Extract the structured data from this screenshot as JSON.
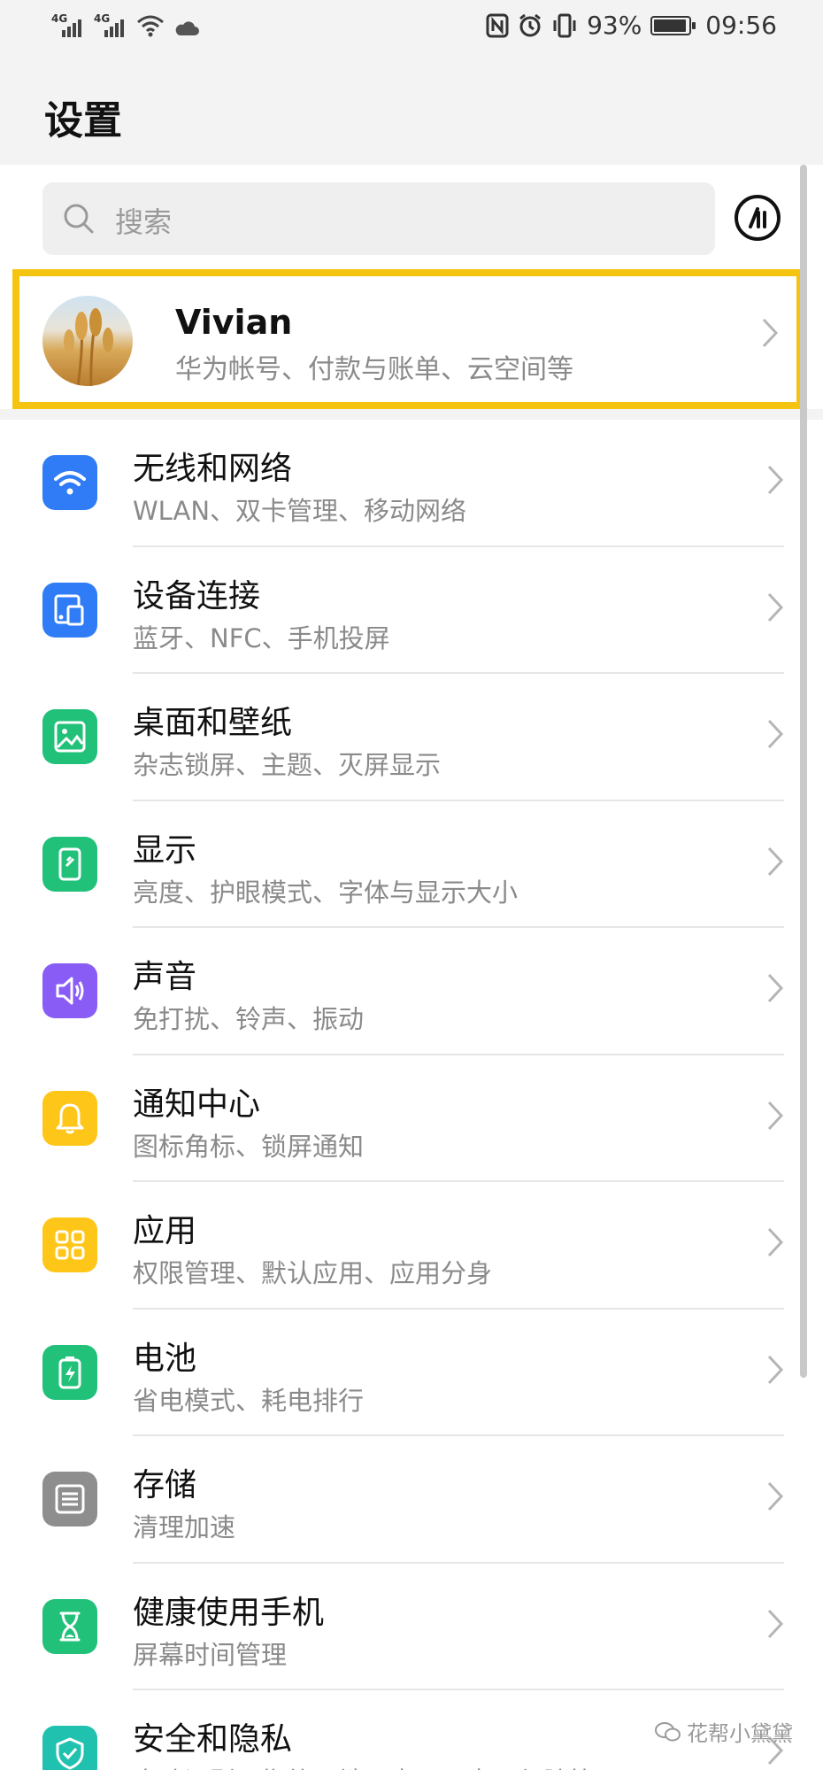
{
  "status_bar": {
    "signal_1": "4G",
    "signal_2": "4G",
    "battery": "93%",
    "time": "09:56"
  },
  "header": {
    "title": "设置"
  },
  "search": {
    "placeholder": "搜索"
  },
  "account": {
    "name": "Vivian",
    "subtitle": "华为帐号、付款与账单、云空间等"
  },
  "items": [
    {
      "title": "无线和网络",
      "sub": "WLAN、双卡管理、移动网络",
      "icon": "wifi-icon",
      "color": "#2f7cf6"
    },
    {
      "title": "设备连接",
      "sub": "蓝牙、NFC、手机投屏",
      "icon": "device-connection-icon",
      "color": "#2f7cf6"
    },
    {
      "title": "桌面和壁纸",
      "sub": "杂志锁屏、主题、灭屏显示",
      "icon": "wallpaper-icon",
      "color": "#21c17a"
    },
    {
      "title": "显示",
      "sub": "亮度、护眼模式、字体与显示大小",
      "icon": "display-icon",
      "color": "#21c17a"
    },
    {
      "title": "声音",
      "sub": "免打扰、铃声、振动",
      "icon": "sound-icon",
      "color": "#8a5cf6"
    },
    {
      "title": "通知中心",
      "sub": "图标角标、锁屏通知",
      "icon": "bell-icon",
      "color": "#ffc61a"
    },
    {
      "title": "应用",
      "sub": "权限管理、默认应用、应用分身",
      "icon": "apps-icon",
      "color": "#ffc61a"
    },
    {
      "title": "电池",
      "sub": "省电模式、耗电排行",
      "icon": "battery-icon",
      "color": "#21c17a"
    },
    {
      "title": "存储",
      "sub": "清理加速",
      "icon": "storage-icon",
      "color": "#8e8e8e"
    },
    {
      "title": "健康使用手机",
      "sub": "屏幕时间管理",
      "icon": "hourglass-icon",
      "color": "#21c17a"
    },
    {
      "title": "安全和隐私",
      "sub": "人脸识别、指纹、锁屏密码、密码保险箱",
      "icon": "shield-icon",
      "color": "#21c1b0"
    }
  ],
  "watermark": "花帮小黛黛"
}
